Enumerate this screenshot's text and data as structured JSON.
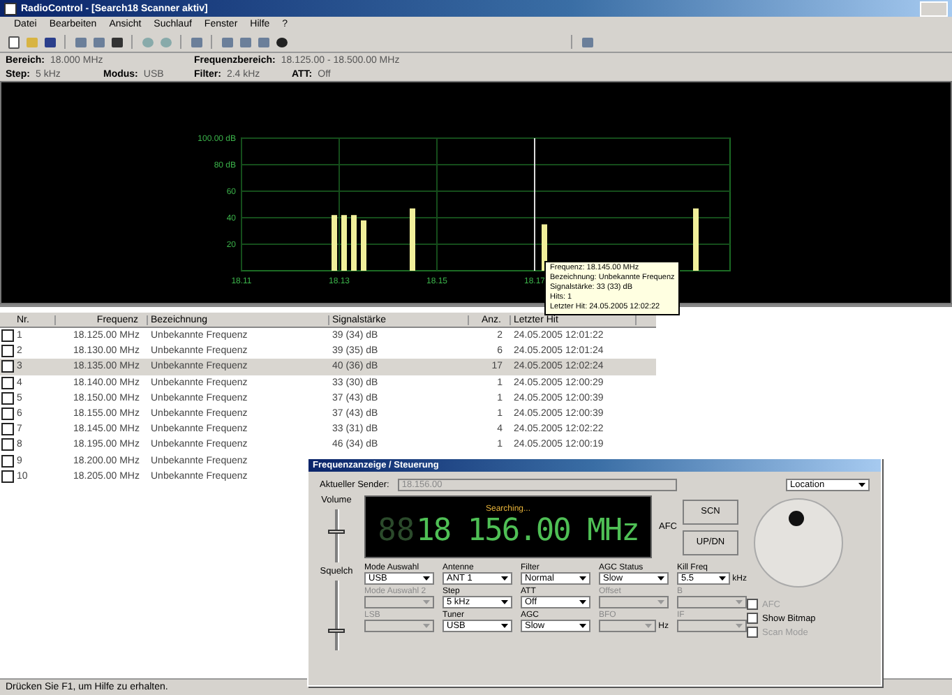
{
  "window": {
    "title": "RadioControl - [Search18 Scanner aktiv]"
  },
  "menu": [
    "Datei",
    "Bearbeiten",
    "Ansicht",
    "Suchlauf",
    "Fenster",
    "Hilfe",
    "?"
  ],
  "info_rows": [
    [
      {
        "label": "Bereich:",
        "value": "18.000 MHz"
      },
      {
        "label": "Frequenzbereich:",
        "value": "18.125.00 - 18.500.00 MHz"
      }
    ],
    [
      {
        "label": "Step:",
        "value": "5 kHz"
      },
      {
        "label": "Modus:",
        "value": "USB"
      },
      {
        "label": "Filter:",
        "value": "2.4 kHz"
      },
      {
        "label": "ATT:",
        "value": "Off"
      }
    ]
  ],
  "spectrum": {
    "chart_data": {
      "type": "bar",
      "x": [
        18.129,
        18.131,
        18.133,
        18.135,
        18.145,
        18.172,
        18.203
      ],
      "values": [
        42,
        42,
        42,
        38,
        47,
        35,
        47
      ],
      "xlim": [
        18.11,
        18.21
      ],
      "ylim": [
        0,
        100
      ],
      "grid": true,
      "ref_lines": [
        {
          "axis": "x",
          "value": 18.17
        }
      ],
      "xticks": [
        {
          "value": 18.11,
          "label": "18.11"
        },
        {
          "value": 18.13,
          "label": "18.13"
        },
        {
          "value": 18.15,
          "label": "18.15"
        },
        {
          "value": 18.17,
          "label": "18.17"
        }
      ],
      "yticks": [
        {
          "value": 20,
          "label": "20"
        },
        {
          "value": 40,
          "label": "40"
        },
        {
          "value": 60,
          "label": "60"
        },
        {
          "value": 80,
          "label": "80 dB"
        },
        {
          "value": 100,
          "label": "100.00 dB"
        }
      ]
    },
    "tooltip": [
      "Frequenz: 18.145.00 MHz",
      "Bezeichnung: Unbekannte Frequenz",
      "Signalstärke: 33 (33) dB",
      "Hits: 1",
      "Letzter Hit: 24.05.2005 12:02:22"
    ]
  },
  "table": {
    "columns": [
      "Nr.",
      "Frequenz",
      "Bezeichnung",
      "Signalstärke",
      "Anz.",
      "Letzter Hit"
    ],
    "rows": [
      {
        "checked": false,
        "selected": false,
        "cells": [
          "1",
          "18.125.00 MHz",
          "Unbekannte Frequenz",
          "39 (34) dB",
          "2",
          "24.05.2005 12:01:22"
        ]
      },
      {
        "checked": false,
        "selected": false,
        "cells": [
          "2",
          "18.130.00 MHz",
          "Unbekannte Frequenz",
          "39 (35) dB",
          "6",
          "24.05.2005 12:01:24"
        ]
      },
      {
        "checked": false,
        "selected": true,
        "cells": [
          "3",
          "18.135.00 MHz",
          "Unbekannte Frequenz",
          "40 (36) dB",
          "17",
          "24.05.2005 12:02:24"
        ]
      },
      {
        "checked": false,
        "selected": false,
        "cells": [
          "4",
          "18.140.00 MHz",
          "Unbekannte Frequenz",
          "33 (30) dB",
          "1",
          "24.05.2005 12:00:29"
        ]
      },
      {
        "checked": false,
        "selected": false,
        "cells": [
          "5",
          "18.150.00 MHz",
          "Unbekannte Frequenz",
          "37 (43) dB",
          "1",
          "24.05.2005 12:00:39"
        ]
      },
      {
        "checked": false,
        "selected": false,
        "cells": [
          "6",
          "18.155.00 MHz",
          "Unbekannte Frequenz",
          "37 (43) dB",
          "1",
          "24.05.2005 12:00:39"
        ]
      },
      {
        "checked": false,
        "selected": false,
        "cells": [
          "7",
          "18.145.00 MHz",
          "Unbekannte Frequenz",
          "33 (31) dB",
          "4",
          "24.05.2005 12:02:22"
        ]
      },
      {
        "checked": false,
        "selected": false,
        "cells": [
          "8",
          "18.195.00 MHz",
          "Unbekannte Frequenz",
          "46 (34) dB",
          "1",
          "24.05.2005 12:00:19"
        ]
      },
      {
        "checked": false,
        "selected": false,
        "cells": [
          "9",
          "18.200.00 MHz",
          "Unbekannte Frequenz"
        ]
      },
      {
        "checked": false,
        "selected": false,
        "cells": [
          "10",
          "18.205.00 MHz",
          "Unbekannte Frequenz"
        ]
      }
    ]
  },
  "dialog": {
    "title": "Frequenzanzeige / Steuerung",
    "sender_label": "Aktueller Sender:",
    "sender_value": "18.156.00",
    "location": "Location",
    "sliders": [
      {
        "label": "Volume",
        "level": 0.6
      },
      {
        "label": "Squelch",
        "level": 0.3
      }
    ],
    "display": {
      "status": "Searching...",
      "dim_digits": "88",
      "frequency": "18 156.00 MHz"
    },
    "side_label": "AFC",
    "buttons": [
      "SCN",
      "UP/DN"
    ],
    "fields": [
      {
        "label": "Mode Auswahl",
        "value": "USB",
        "disabled": false
      },
      {
        "label": "Antenne",
        "value": "ANT 1",
        "disabled": false
      },
      {
        "label": "Filter",
        "value": "Normal",
        "disabled": false
      },
      {
        "label": "AGC Status",
        "value": "Slow",
        "disabled": false
      },
      {
        "label": "Kill Freq",
        "value": "5.5",
        "unit": "kHz",
        "disabled": false
      },
      {
        "label": "Mode Auswahl 2",
        "disabled": true
      },
      {
        "label": "Step",
        "value": "5 kHz",
        "disabled": false
      },
      {
        "label": "ATT",
        "value": "Off",
        "disabled": false
      },
      {
        "label": "Offset",
        "disabled": true
      },
      {
        "label": "B",
        "disabled": true
      },
      {
        "label": "LSB",
        "disabled": true
      },
      {
        "label": "Tuner",
        "value": "USB",
        "disabled": false
      },
      {
        "label": "AGC",
        "value": "Slow",
        "disabled": false
      },
      {
        "label": "BFO",
        "unit": "Hz",
        "disabled": true
      },
      {
        "label": "IF",
        "disabled": true
      }
    ],
    "options": [
      {
        "label": "AFC",
        "checked": false,
        "disabled": true
      },
      {
        "label": "Show Bitmap",
        "checked": false,
        "disabled": false
      },
      {
        "label": "Scan Mode",
        "checked": false,
        "disabled": true
      }
    ]
  },
  "status_bar": "Drücken Sie F1, um Hilfe zu erhalten."
}
